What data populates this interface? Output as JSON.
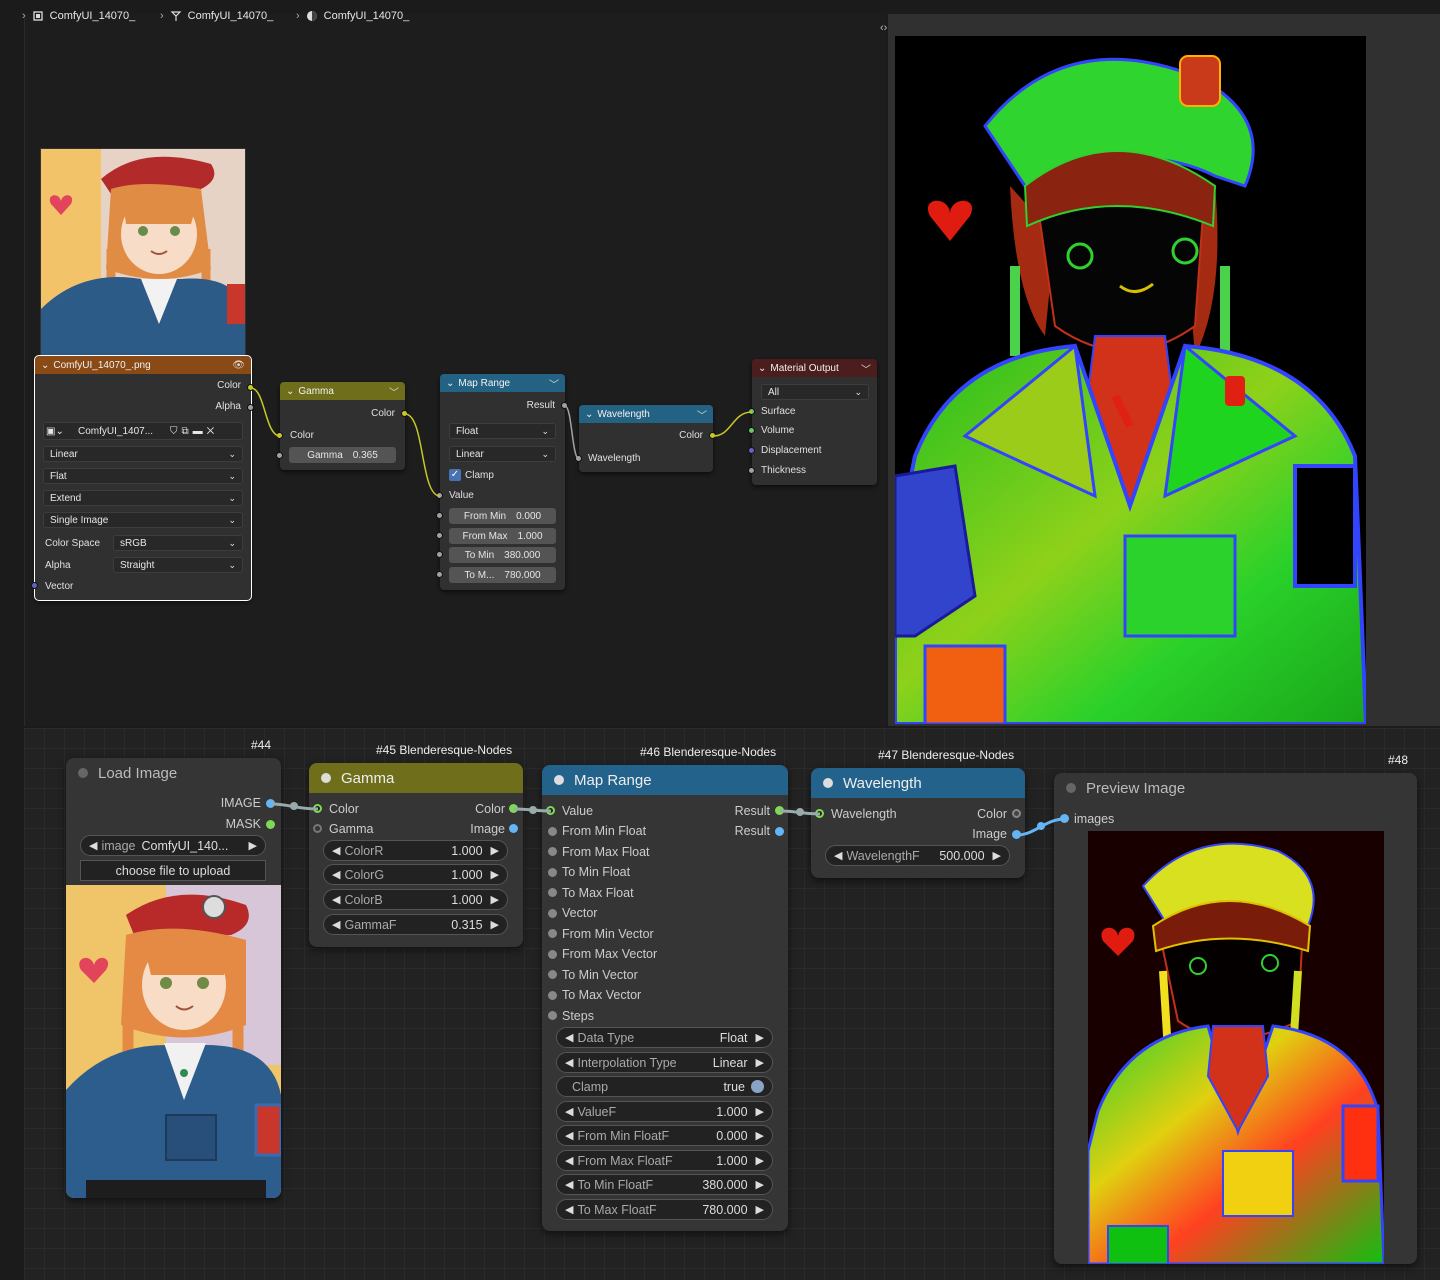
{
  "blender": {
    "breadcrumbs": [
      "ComfyUI_14070_",
      "ComfyUI_14070_",
      "ComfyUI_14070_"
    ],
    "image_node": {
      "title": "ComfyUI_14070_.png",
      "out_color": "Color",
      "out_alpha": "Alpha",
      "image_name": "ComfyUI_1407...",
      "interpolation": "Linear",
      "projection": "Flat",
      "extension": "Extend",
      "source": "Single Image",
      "color_space_label": "Color Space",
      "color_space": "sRGB",
      "alpha_label": "Alpha",
      "alpha": "Straight",
      "vector": "Vector"
    },
    "gamma_node": {
      "title": "Gamma",
      "out_color": "Color",
      "in_color": "Color",
      "gamma_label": "Gamma",
      "gamma_value": "0.365"
    },
    "map_range_node": {
      "title": "Map Range",
      "result": "Result",
      "data_type": "Float",
      "interp": "Linear",
      "clamp": "Clamp",
      "value": "Value",
      "from_min_label": "From Min",
      "from_min": "0.000",
      "from_max_label": "From Max",
      "from_max": "1.000",
      "to_min_label": "To Min",
      "to_min": "380.000",
      "to_max_label": "To M...",
      "to_max": "780.000"
    },
    "wavelength_node": {
      "title": "Wavelength",
      "out_color": "Color",
      "in_wavelength": "Wavelength"
    },
    "material_output_node": {
      "title": "Material Output",
      "target": "All",
      "surface": "Surface",
      "volume": "Volume",
      "displacement": "Displacement",
      "thickness": "Thickness"
    },
    "colors": {
      "image_header": "#8a4a16",
      "gamma_header": "#6e6e1b",
      "converter_header": "#246283",
      "output_header": "#4b1d1d"
    }
  },
  "comfy": {
    "load_image": {
      "id": "#44",
      "title": "Load Image",
      "out_image": "IMAGE",
      "out_mask": "MASK",
      "image_label": "image",
      "image_value": "ComfyUI_140...",
      "upload": "choose file to upload"
    },
    "gamma": {
      "id": "#45 Blenderesque-Nodes",
      "title": "Gamma",
      "in_color": "Color",
      "in_gamma": "Gamma",
      "out_color": "Color",
      "out_image": "Image",
      "widgets": [
        {
          "label": "ColorR",
          "value": "1.000"
        },
        {
          "label": "ColorG",
          "value": "1.000"
        },
        {
          "label": "ColorB",
          "value": "1.000"
        },
        {
          "label": "GammaF",
          "value": "0.315"
        }
      ]
    },
    "map_range": {
      "id": "#46 Blenderesque-Nodes",
      "title": "Map Range",
      "inputs": [
        "Value",
        "From Min Float",
        "From Max Float",
        "To Min Float",
        "To Max Float",
        "Vector",
        "From Min Vector",
        "From Max Vector",
        "To Min Vector",
        "To Max Vector",
        "Steps"
      ],
      "outputs": [
        "Result",
        "Result"
      ],
      "widgets": [
        {
          "label": "Data Type",
          "value": "Float"
        },
        {
          "label": "Interpolation Type",
          "value": "Linear"
        },
        {
          "label": "Clamp",
          "value": "true"
        },
        {
          "label": "ValueF",
          "value": "1.000"
        },
        {
          "label": "From Min FloatF",
          "value": "0.000"
        },
        {
          "label": "From Max FloatF",
          "value": "1.000"
        },
        {
          "label": "To Min FloatF",
          "value": "380.000"
        },
        {
          "label": "To Max FloatF",
          "value": "780.000"
        }
      ]
    },
    "wavelength": {
      "id": "#47 Blenderesque-Nodes",
      "title": "Wavelength",
      "in_wavelength": "Wavelength",
      "out_color": "Color",
      "out_image": "Image",
      "widget_label": "WavelengthF",
      "widget_value": "500.000"
    },
    "preview": {
      "id": "#48",
      "title": "Preview Image",
      "in_images": "images"
    },
    "colors": {
      "gamma_header": "#6e6e1b",
      "blue_header": "#23628a",
      "grey_header": "#353535"
    }
  }
}
